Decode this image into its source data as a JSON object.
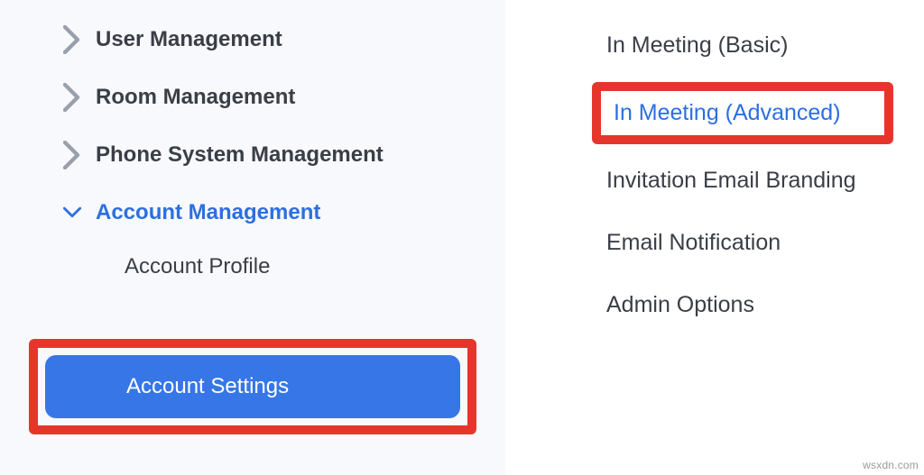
{
  "sidebar": {
    "items": [
      {
        "label": "User Management",
        "expanded": false
      },
      {
        "label": "Room Management",
        "expanded": false
      },
      {
        "label": "Phone System Management",
        "expanded": false
      },
      {
        "label": "Account Management",
        "expanded": true
      }
    ],
    "sub_items": {
      "account_profile": "Account Profile",
      "account_settings": "Account Settings"
    }
  },
  "right_panel": {
    "in_meeting_basic": "In Meeting (Basic)",
    "in_meeting_advanced": "In Meeting (Advanced)",
    "invitation_email_branding": "Invitation Email Branding",
    "email_notification": "Email Notification",
    "admin_options": "Admin Options"
  },
  "colors": {
    "accent": "#2d6fe0",
    "highlight": "#e6362c",
    "pill": "#3776e6"
  },
  "watermark": "wsxdn.com"
}
